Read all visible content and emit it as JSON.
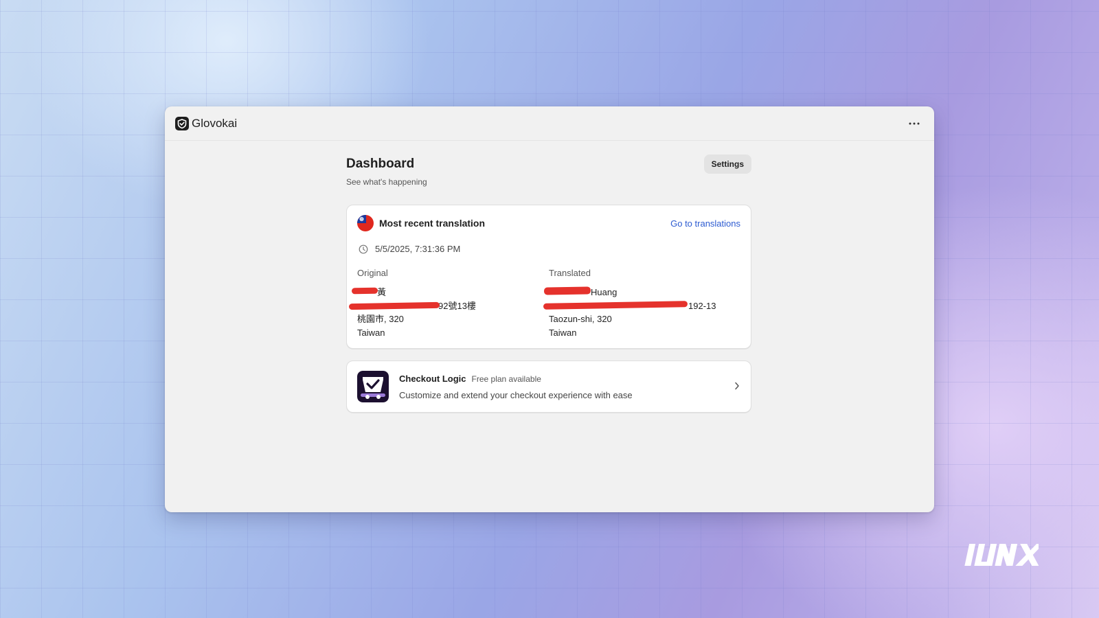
{
  "app": {
    "name": "Glovokai"
  },
  "dashboard": {
    "title": "Dashboard",
    "subtitle": "See what's happening",
    "settings_label": "Settings"
  },
  "recent_translation": {
    "title": "Most recent translation",
    "link_label": "Go to translations",
    "timestamp": "5/5/2025, 7:31:36 PM",
    "original": {
      "label": "Original",
      "lines": [
        "黃",
        "92號13樓",
        "桃園市, 320",
        "Taiwan"
      ]
    },
    "translated": {
      "label": "Translated",
      "lines": [
        "Huang",
        "192-13",
        "Taozun-shi, 320",
        "Taiwan"
      ]
    }
  },
  "app_card": {
    "name": "Checkout Logic",
    "plan": "Free plan available",
    "description": "Customize and extend your checkout experience with ease"
  },
  "colors": {
    "link": "#2c5bd1",
    "redaction": "#e5322c",
    "app_icon_bg": "#1c1030"
  },
  "icons": {
    "brand": "glovokai-logo-icon",
    "more": "more-horizontal-icon",
    "flag": "taiwan-flag-icon",
    "clock": "clock-icon",
    "app": "checkout-logic-app-icon",
    "chevron": "chevron-right-icon",
    "watermark": "inux-logo"
  }
}
